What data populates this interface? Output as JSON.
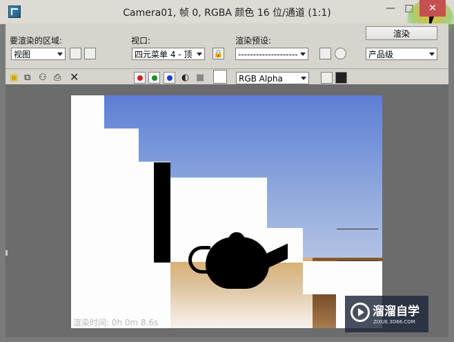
{
  "window": {
    "title": "Camera01, 帧 0, RGBA 颜色 16 位/通道 (1:1)",
    "minimize_glyph": "—",
    "maximize_glyph": "□",
    "close_glyph": "✕"
  },
  "panel": {
    "area_label": "要渲染的区域:",
    "area_value": "视图",
    "viewport_label": "视口:",
    "viewport_value": "四元菜单 4 - 顶",
    "preset_label": "渲染预设:",
    "preset_value": "--------------------",
    "render_button": "渲染",
    "quality_value": "产品级",
    "channel_value": "RGB Alpha",
    "close_x": "✕",
    "icons": [
      "save-icon",
      "copy-icon",
      "clone-icon",
      "print-icon",
      "clear-icon",
      "lock-icon",
      "red-channel",
      "green-channel",
      "blue-channel",
      "mono-channel",
      "alpha-channel",
      "color-swatch",
      "display-icon",
      "frame-icon"
    ]
  },
  "viewport": {
    "status_text": "渲染时间: 0h 0m 8.6s"
  },
  "watermark": {
    "title": "溜溜自学",
    "subtitle": "ZIXUE.3D66.COM"
  },
  "colors": {
    "close_red": "#c75050",
    "channel_red": "#d32020",
    "channel_green": "#1f8a2a",
    "channel_blue": "#1d3fcf"
  }
}
